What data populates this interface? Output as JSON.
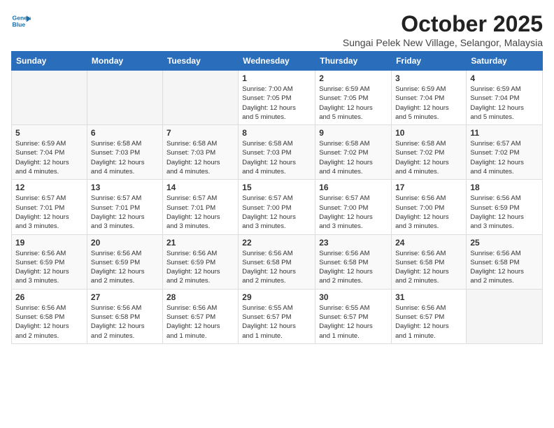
{
  "logo": {
    "line1": "General",
    "line2": "Blue"
  },
  "title": "October 2025",
  "subtitle": "Sungai Pelek New Village, Selangor, Malaysia",
  "days_of_week": [
    "Sunday",
    "Monday",
    "Tuesday",
    "Wednesday",
    "Thursday",
    "Friday",
    "Saturday"
  ],
  "weeks": [
    [
      {
        "day": "",
        "info": ""
      },
      {
        "day": "",
        "info": ""
      },
      {
        "day": "",
        "info": ""
      },
      {
        "day": "1",
        "info": "Sunrise: 7:00 AM\nSunset: 7:05 PM\nDaylight: 12 hours\nand 5 minutes."
      },
      {
        "day": "2",
        "info": "Sunrise: 6:59 AM\nSunset: 7:05 PM\nDaylight: 12 hours\nand 5 minutes."
      },
      {
        "day": "3",
        "info": "Sunrise: 6:59 AM\nSunset: 7:04 PM\nDaylight: 12 hours\nand 5 minutes."
      },
      {
        "day": "4",
        "info": "Sunrise: 6:59 AM\nSunset: 7:04 PM\nDaylight: 12 hours\nand 5 minutes."
      }
    ],
    [
      {
        "day": "5",
        "info": "Sunrise: 6:59 AM\nSunset: 7:04 PM\nDaylight: 12 hours\nand 4 minutes."
      },
      {
        "day": "6",
        "info": "Sunrise: 6:58 AM\nSunset: 7:03 PM\nDaylight: 12 hours\nand 4 minutes."
      },
      {
        "day": "7",
        "info": "Sunrise: 6:58 AM\nSunset: 7:03 PM\nDaylight: 12 hours\nand 4 minutes."
      },
      {
        "day": "8",
        "info": "Sunrise: 6:58 AM\nSunset: 7:03 PM\nDaylight: 12 hours\nand 4 minutes."
      },
      {
        "day": "9",
        "info": "Sunrise: 6:58 AM\nSunset: 7:02 PM\nDaylight: 12 hours\nand 4 minutes."
      },
      {
        "day": "10",
        "info": "Sunrise: 6:58 AM\nSunset: 7:02 PM\nDaylight: 12 hours\nand 4 minutes."
      },
      {
        "day": "11",
        "info": "Sunrise: 6:57 AM\nSunset: 7:02 PM\nDaylight: 12 hours\nand 4 minutes."
      }
    ],
    [
      {
        "day": "12",
        "info": "Sunrise: 6:57 AM\nSunset: 7:01 PM\nDaylight: 12 hours\nand 3 minutes."
      },
      {
        "day": "13",
        "info": "Sunrise: 6:57 AM\nSunset: 7:01 PM\nDaylight: 12 hours\nand 3 minutes."
      },
      {
        "day": "14",
        "info": "Sunrise: 6:57 AM\nSunset: 7:01 PM\nDaylight: 12 hours\nand 3 minutes."
      },
      {
        "day": "15",
        "info": "Sunrise: 6:57 AM\nSunset: 7:00 PM\nDaylight: 12 hours\nand 3 minutes."
      },
      {
        "day": "16",
        "info": "Sunrise: 6:57 AM\nSunset: 7:00 PM\nDaylight: 12 hours\nand 3 minutes."
      },
      {
        "day": "17",
        "info": "Sunrise: 6:56 AM\nSunset: 7:00 PM\nDaylight: 12 hours\nand 3 minutes."
      },
      {
        "day": "18",
        "info": "Sunrise: 6:56 AM\nSunset: 6:59 PM\nDaylight: 12 hours\nand 3 minutes."
      }
    ],
    [
      {
        "day": "19",
        "info": "Sunrise: 6:56 AM\nSunset: 6:59 PM\nDaylight: 12 hours\nand 3 minutes."
      },
      {
        "day": "20",
        "info": "Sunrise: 6:56 AM\nSunset: 6:59 PM\nDaylight: 12 hours\nand 2 minutes."
      },
      {
        "day": "21",
        "info": "Sunrise: 6:56 AM\nSunset: 6:59 PM\nDaylight: 12 hours\nand 2 minutes."
      },
      {
        "day": "22",
        "info": "Sunrise: 6:56 AM\nSunset: 6:58 PM\nDaylight: 12 hours\nand 2 minutes."
      },
      {
        "day": "23",
        "info": "Sunrise: 6:56 AM\nSunset: 6:58 PM\nDaylight: 12 hours\nand 2 minutes."
      },
      {
        "day": "24",
        "info": "Sunrise: 6:56 AM\nSunset: 6:58 PM\nDaylight: 12 hours\nand 2 minutes."
      },
      {
        "day": "25",
        "info": "Sunrise: 6:56 AM\nSunset: 6:58 PM\nDaylight: 12 hours\nand 2 minutes."
      }
    ],
    [
      {
        "day": "26",
        "info": "Sunrise: 6:56 AM\nSunset: 6:58 PM\nDaylight: 12 hours\nand 2 minutes."
      },
      {
        "day": "27",
        "info": "Sunrise: 6:56 AM\nSunset: 6:58 PM\nDaylight: 12 hours\nand 2 minutes."
      },
      {
        "day": "28",
        "info": "Sunrise: 6:56 AM\nSunset: 6:57 PM\nDaylight: 12 hours\nand 1 minute."
      },
      {
        "day": "29",
        "info": "Sunrise: 6:55 AM\nSunset: 6:57 PM\nDaylight: 12 hours\nand 1 minute."
      },
      {
        "day": "30",
        "info": "Sunrise: 6:55 AM\nSunset: 6:57 PM\nDaylight: 12 hours\nand 1 minute."
      },
      {
        "day": "31",
        "info": "Sunrise: 6:56 AM\nSunset: 6:57 PM\nDaylight: 12 hours\nand 1 minute."
      },
      {
        "day": "",
        "info": ""
      }
    ]
  ]
}
